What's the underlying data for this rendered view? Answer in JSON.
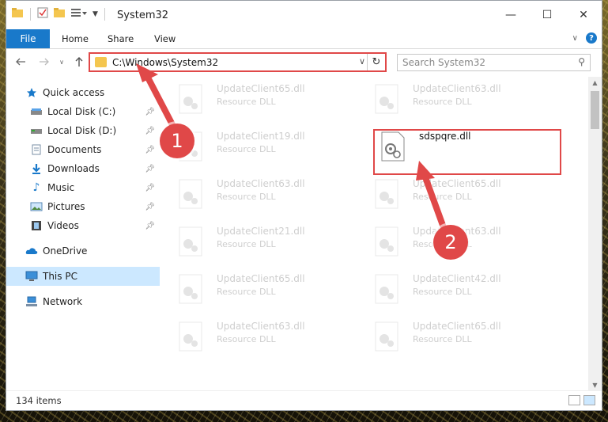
{
  "window": {
    "title": "System32",
    "controls": {
      "minimize": "—",
      "maximize": "☐",
      "close": "✕"
    }
  },
  "ribbon": {
    "file_tab": "File",
    "tabs": [
      "Home",
      "Share",
      "View"
    ]
  },
  "address_bar": {
    "path": "C:\\Windows\\System32"
  },
  "search": {
    "placeholder": "Search System32"
  },
  "sidebar": {
    "items": [
      {
        "label": "Quick access",
        "icon": "star-icon"
      },
      {
        "label": "Local Disk (C:)",
        "icon": "drive-icon",
        "pinned": true
      },
      {
        "label": "Local Disk (D:)",
        "icon": "drive-icon",
        "pinned": true
      },
      {
        "label": "Documents",
        "icon": "documents-icon",
        "pinned": true
      },
      {
        "label": "Downloads",
        "icon": "downloads-icon",
        "pinned": true
      },
      {
        "label": "Music",
        "icon": "music-icon",
        "pinned": true
      },
      {
        "label": "Pictures",
        "icon": "pictures-icon",
        "pinned": true
      },
      {
        "label": "Videos",
        "icon": "videos-icon",
        "pinned": true
      },
      {
        "label": "OneDrive",
        "icon": "onedrive-icon"
      },
      {
        "label": "This PC",
        "icon": "this-pc-icon",
        "selected": true
      },
      {
        "label": "Network",
        "icon": "network-icon"
      }
    ]
  },
  "files": {
    "left_column": [
      {
        "name": "UpdateClient65.dll",
        "type": "Resource DLL"
      },
      {
        "name": "UpdateClient19.dll",
        "type": "Resource DLL"
      },
      {
        "name": "UpdateClient63.dll",
        "type": "Resource DLL"
      },
      {
        "name": "UpdateClient21.dll",
        "type": "Resource DLL"
      },
      {
        "name": "UpdateClient65.dll",
        "type": "Resource DLL"
      },
      {
        "name": "UpdateClient63.dll",
        "type": "Resource DLL"
      }
    ],
    "right_column": [
      {
        "name": "UpdateClient63.dll",
        "type": "Resource DLL"
      },
      {
        "name": "sdspqre.dll",
        "type": ""
      },
      {
        "name": "UpdateClient65.dll",
        "type": "Resource DLL"
      },
      {
        "name": "UpdateClient63.dll",
        "type": "Resource DLL"
      },
      {
        "name": "UpdateClient42.dll",
        "type": "Resource DLL"
      },
      {
        "name": "UpdateClient65.dll",
        "type": "Resource DLL"
      }
    ]
  },
  "status": {
    "item_count": "134 items"
  },
  "annotations": {
    "marker_1": "1",
    "marker_2": "2"
  },
  "colors": {
    "accent": "#1979ca",
    "highlight": "#e04848",
    "selected": "#cce8ff"
  }
}
